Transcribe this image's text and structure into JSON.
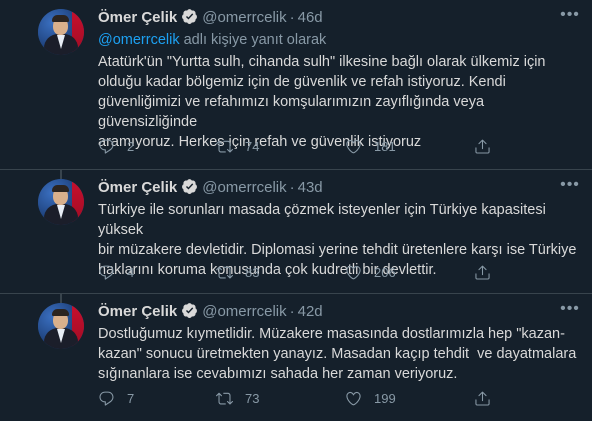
{
  "tweets": [
    {
      "name": "Ömer Çelik",
      "handle": "@omerrcelik",
      "dot": "·",
      "time": "46d",
      "reply_prefix": "@omerrcelik",
      "reply_suffix": " adlı kişiye yanıt olarak",
      "text": "Atatürk'ün \"Yurtta sulh, cihanda sulh\" ilkesine bağlı olarak ülkemiz için\nolduğu kadar bölgemiz için de güvenlik ve refah istiyoruz. Kendi\ngüvenliğimizi ve refahımızı komşularımızın zayıflığında veya güvensizliğinde\naramıyoruz. Herkes için refah ve güvenlik istiyoruz",
      "replies": "2",
      "retweets": "74",
      "likes": "181"
    },
    {
      "name": "Ömer Çelik",
      "handle": "@omerrcelik",
      "dot": "·",
      "time": "43d",
      "text": "Türkiye ile sorunları masada çözmek isteyenler için Türkiye kapasitesi yüksek\nbir müzakere devletidir. Diplomasi yerine tehdit üretenlere karşı ise Türkiye\nhaklarını koruma konusunda çok kudretli bir devlettir.",
      "replies": "4",
      "retweets": "83",
      "likes": "206"
    },
    {
      "name": "Ömer Çelik",
      "handle": "@omerrcelik",
      "dot": "·",
      "time": "42d",
      "text": "Dostluğumuz kıymetlidir. Müzakere masasında dostlarımızla hep \"kazan-\nkazan\" sonucu üretmekten yanayız. Masadan kaçıp tehdit  ve dayatmalara\nsığınanlara ise cevabımızı sahada her zaman veriyoruz.",
      "replies": "7",
      "retweets": "73",
      "likes": "199"
    }
  ],
  "icons": {
    "verified": "verified-badge-icon",
    "more": "more-options-icon",
    "reply": "reply-icon",
    "retweet": "retweet-icon",
    "like": "heart-icon",
    "share": "share-icon"
  },
  "colors": {
    "background": "#15202b",
    "text": "#d9d9d9",
    "secondary": "#8899a6",
    "accent": "#1da1f2",
    "divider": "#38444d"
  }
}
